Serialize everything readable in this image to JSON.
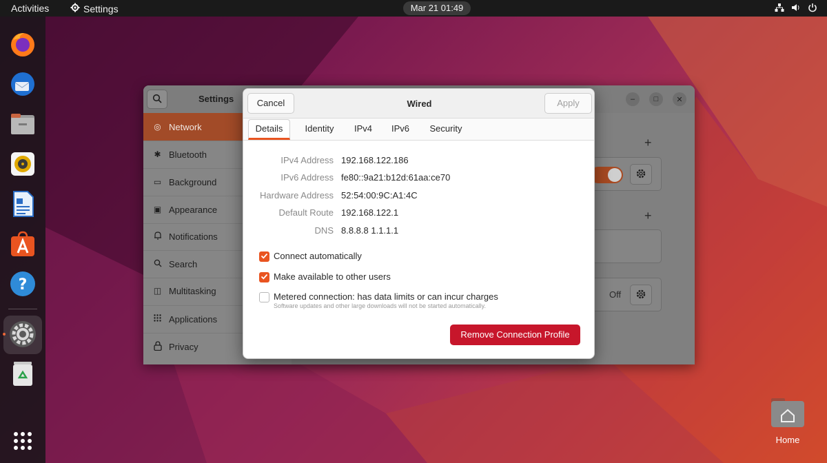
{
  "topbar": {
    "activities": "Activities",
    "app_name": "Settings",
    "clock": "Mar 21  01:49",
    "tray": [
      "network-icon",
      "volume-icon",
      "power-icon"
    ]
  },
  "dock": {
    "items": [
      "Firefox",
      "Thunderbird",
      "Files",
      "Rhythmbox",
      "LibreOffice Writer",
      "Ubuntu Software",
      "Help",
      "Settings",
      "Trash",
      "Show Applications"
    ],
    "active": "Settings"
  },
  "desktop": {
    "home_label": "Home"
  },
  "settings": {
    "title": "Settings",
    "sidebar": [
      {
        "icon": "network-icon",
        "glyph": "◎",
        "label": "Network"
      },
      {
        "icon": "bluetooth-icon",
        "glyph": "✱",
        "label": "Bluetooth"
      },
      {
        "icon": "background-icon",
        "glyph": "▭",
        "label": "Background"
      },
      {
        "icon": "appearance-icon",
        "glyph": "▣",
        "label": "Appearance"
      },
      {
        "icon": "bell-icon",
        "glyph": "♫",
        "label": "Notifications"
      },
      {
        "icon": "search-icon",
        "glyph": "⚲",
        "label": "Search"
      },
      {
        "icon": "multitasking-icon",
        "glyph": "◫",
        "label": "Multitasking"
      },
      {
        "icon": "applications-icon",
        "glyph": "⁞⁞",
        "label": "Applications"
      },
      {
        "icon": "lock-icon",
        "glyph": "🔒",
        "label": "Privacy"
      }
    ],
    "selected": "Network",
    "content": {
      "vpn_off_label": "Off"
    }
  },
  "dialog": {
    "title": "Wired",
    "cancel_label": "Cancel",
    "apply_label": "Apply",
    "tabs": [
      "Details",
      "Identity",
      "IPv4",
      "IPv6",
      "Security"
    ],
    "active_tab": "Details",
    "details": [
      {
        "label": "IPv4 Address",
        "value": "192.168.122.186"
      },
      {
        "label": "IPv6 Address",
        "value": "fe80::9a21:b12d:61aa:ce70"
      },
      {
        "label": "Hardware Address",
        "value": "52:54:00:9C:A1:4C"
      },
      {
        "label": "Default Route",
        "value": "192.168.122.1"
      },
      {
        "label": "DNS",
        "value": "8.8.8.8 1.1.1.1"
      }
    ],
    "options": [
      {
        "label": "Connect automatically",
        "checked": true
      },
      {
        "label": "Make available to other users",
        "checked": true
      },
      {
        "label": "Metered connection: has data limits or can incur charges",
        "sublabel": "Software updates and other large downloads will not be started automatically.",
        "checked": false
      }
    ],
    "remove_label": "Remove Connection Profile"
  },
  "colors": {
    "accent": "#e95420",
    "danger": "#c7162b"
  }
}
